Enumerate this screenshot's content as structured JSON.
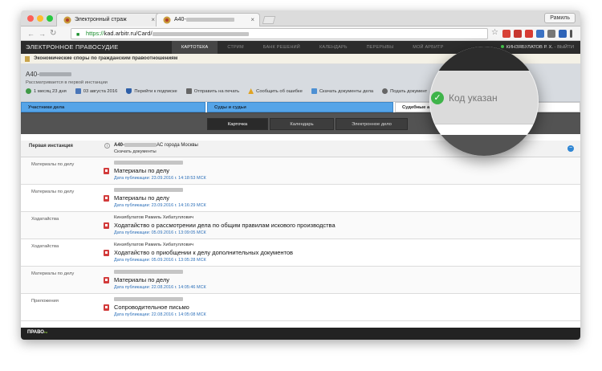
{
  "browser": {
    "tabs": [
      {
        "title": "Электронный страж"
      },
      {
        "title": "А40-"
      }
    ],
    "user_button": "Рамиль",
    "url_scheme": "https://",
    "url_rest": "kad.arbitr.ru/Card/"
  },
  "site": {
    "logo": "ЭЛЕКТРОННОЕ ПРАВОСУДИЕ",
    "nav": [
      "КАРТОТЕКА",
      "СТРИМ",
      "БАНК РЕШЕНИЙ",
      "КАЛЕНДАРЬ",
      "ПЕРЕРЫВЫ",
      "МОЙ АРБИТР"
    ],
    "user": "КИНЗЯБУЛАТОВ Р. Х.",
    "logout": "ВЫЙТИ"
  },
  "case": {
    "category": "Экономические споры по гражданским правоотношениям",
    "number": "А40-",
    "instance": "Рассматривается в первой инстанции",
    "actions": [
      {
        "label": "1 месяц 23 дня",
        "icon": "clock-icon",
        "color": "#3f9a47"
      },
      {
        "label": "03 августа 2016",
        "icon": "calendar-icon",
        "color": "#4a76b8"
      },
      {
        "label": "Перейти к подписке",
        "icon": "shield-icon",
        "color": "#2e5fa8"
      },
      {
        "label": "Отправить на печать",
        "icon": "printer-icon",
        "color": "#666666"
      },
      {
        "label": "Сообщить об ошибке",
        "icon": "alert-icon",
        "color": "#e0a323"
      },
      {
        "label": "Скачать документы дела",
        "icon": "download-icon",
        "color": "#4d90d3"
      },
      {
        "label": "Подать документ",
        "icon": "plus-icon",
        "color": "#666666"
      }
    ]
  },
  "participants": {
    "tabs": [
      "Участники дела",
      "Суды и судьи",
      "Судебные а"
    ]
  },
  "view_tabs": [
    "Карточка",
    "Календарь",
    "Электронное дело"
  ],
  "first_instance": {
    "label": "Первая инстанция",
    "court_prefix": "А40-",
    "court_suffix": "АС города Москвы",
    "download": "Скачать документы"
  },
  "entries": [
    {
      "category": "Материалы по делу",
      "author": "",
      "title": "Материалы по делу",
      "published": "Дата публикации: 23.09.2016 г. 14:18:53 МСК"
    },
    {
      "category": "Материалы по делу",
      "author": "",
      "title": "Материалы по делу",
      "published": "Дата публикации: 23.09.2016 г. 14:16:29 МСК"
    },
    {
      "category": "Ходатайства",
      "author": "Кинзябулатов Рамиль Хибатуллович",
      "title": "Ходатайство о рассмотрении дела по общим правилам искового производства",
      "published": "Дата публикации: 05.09.2016 г. 13:09:05 МСК"
    },
    {
      "category": "Ходатайства",
      "author": "Кинзябулатов Рамиль Хибатуллович",
      "title": "Ходатайство о приобщении к делу дополнительных документов",
      "published": "Дата публикации: 05.09.2016 г. 13:05:28 МСК"
    },
    {
      "category": "Материалы по делу",
      "author": "",
      "title": "Материалы по делу",
      "published": "Дата публикации: 22.08.2016 г. 14:05:46 МСК"
    },
    {
      "category": "Приложения",
      "author": "",
      "title": "Сопроводительное письмо",
      "published": "Дата публикации: 22.08.2016 г. 14:05:08 МСК"
    }
  ],
  "footer": {
    "logo_main": "ПРАВО",
    "logo_sup": "ru"
  },
  "magnifier": {
    "text": "Код указан",
    "check": "✓"
  }
}
